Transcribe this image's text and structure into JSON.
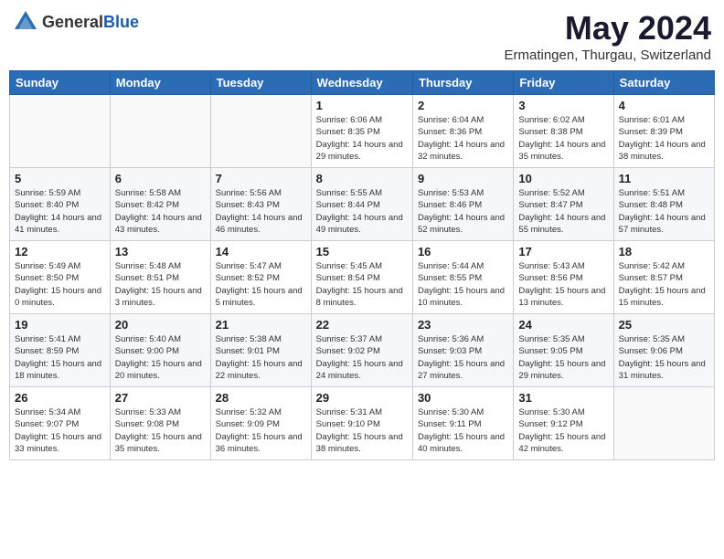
{
  "header": {
    "logo_general": "General",
    "logo_blue": "Blue",
    "month_year": "May 2024",
    "location": "Ermatingen, Thurgau, Switzerland"
  },
  "weekdays": [
    "Sunday",
    "Monday",
    "Tuesday",
    "Wednesday",
    "Thursday",
    "Friday",
    "Saturday"
  ],
  "weeks": [
    [
      {
        "day": "",
        "info": ""
      },
      {
        "day": "",
        "info": ""
      },
      {
        "day": "",
        "info": ""
      },
      {
        "day": "1",
        "info": "Sunrise: 6:06 AM\nSunset: 8:35 PM\nDaylight: 14 hours\nand 29 minutes."
      },
      {
        "day": "2",
        "info": "Sunrise: 6:04 AM\nSunset: 8:36 PM\nDaylight: 14 hours\nand 32 minutes."
      },
      {
        "day": "3",
        "info": "Sunrise: 6:02 AM\nSunset: 8:38 PM\nDaylight: 14 hours\nand 35 minutes."
      },
      {
        "day": "4",
        "info": "Sunrise: 6:01 AM\nSunset: 8:39 PM\nDaylight: 14 hours\nand 38 minutes."
      }
    ],
    [
      {
        "day": "5",
        "info": "Sunrise: 5:59 AM\nSunset: 8:40 PM\nDaylight: 14 hours\nand 41 minutes."
      },
      {
        "day": "6",
        "info": "Sunrise: 5:58 AM\nSunset: 8:42 PM\nDaylight: 14 hours\nand 43 minutes."
      },
      {
        "day": "7",
        "info": "Sunrise: 5:56 AM\nSunset: 8:43 PM\nDaylight: 14 hours\nand 46 minutes."
      },
      {
        "day": "8",
        "info": "Sunrise: 5:55 AM\nSunset: 8:44 PM\nDaylight: 14 hours\nand 49 minutes."
      },
      {
        "day": "9",
        "info": "Sunrise: 5:53 AM\nSunset: 8:46 PM\nDaylight: 14 hours\nand 52 minutes."
      },
      {
        "day": "10",
        "info": "Sunrise: 5:52 AM\nSunset: 8:47 PM\nDaylight: 14 hours\nand 55 minutes."
      },
      {
        "day": "11",
        "info": "Sunrise: 5:51 AM\nSunset: 8:48 PM\nDaylight: 14 hours\nand 57 minutes."
      }
    ],
    [
      {
        "day": "12",
        "info": "Sunrise: 5:49 AM\nSunset: 8:50 PM\nDaylight: 15 hours\nand 0 minutes."
      },
      {
        "day": "13",
        "info": "Sunrise: 5:48 AM\nSunset: 8:51 PM\nDaylight: 15 hours\nand 3 minutes."
      },
      {
        "day": "14",
        "info": "Sunrise: 5:47 AM\nSunset: 8:52 PM\nDaylight: 15 hours\nand 5 minutes."
      },
      {
        "day": "15",
        "info": "Sunrise: 5:45 AM\nSunset: 8:54 PM\nDaylight: 15 hours\nand 8 minutes."
      },
      {
        "day": "16",
        "info": "Sunrise: 5:44 AM\nSunset: 8:55 PM\nDaylight: 15 hours\nand 10 minutes."
      },
      {
        "day": "17",
        "info": "Sunrise: 5:43 AM\nSunset: 8:56 PM\nDaylight: 15 hours\nand 13 minutes."
      },
      {
        "day": "18",
        "info": "Sunrise: 5:42 AM\nSunset: 8:57 PM\nDaylight: 15 hours\nand 15 minutes."
      }
    ],
    [
      {
        "day": "19",
        "info": "Sunrise: 5:41 AM\nSunset: 8:59 PM\nDaylight: 15 hours\nand 18 minutes."
      },
      {
        "day": "20",
        "info": "Sunrise: 5:40 AM\nSunset: 9:00 PM\nDaylight: 15 hours\nand 20 minutes."
      },
      {
        "day": "21",
        "info": "Sunrise: 5:38 AM\nSunset: 9:01 PM\nDaylight: 15 hours\nand 22 minutes."
      },
      {
        "day": "22",
        "info": "Sunrise: 5:37 AM\nSunset: 9:02 PM\nDaylight: 15 hours\nand 24 minutes."
      },
      {
        "day": "23",
        "info": "Sunrise: 5:36 AM\nSunset: 9:03 PM\nDaylight: 15 hours\nand 27 minutes."
      },
      {
        "day": "24",
        "info": "Sunrise: 5:35 AM\nSunset: 9:05 PM\nDaylight: 15 hours\nand 29 minutes."
      },
      {
        "day": "25",
        "info": "Sunrise: 5:35 AM\nSunset: 9:06 PM\nDaylight: 15 hours\nand 31 minutes."
      }
    ],
    [
      {
        "day": "26",
        "info": "Sunrise: 5:34 AM\nSunset: 9:07 PM\nDaylight: 15 hours\nand 33 minutes."
      },
      {
        "day": "27",
        "info": "Sunrise: 5:33 AM\nSunset: 9:08 PM\nDaylight: 15 hours\nand 35 minutes."
      },
      {
        "day": "28",
        "info": "Sunrise: 5:32 AM\nSunset: 9:09 PM\nDaylight: 15 hours\nand 36 minutes."
      },
      {
        "day": "29",
        "info": "Sunrise: 5:31 AM\nSunset: 9:10 PM\nDaylight: 15 hours\nand 38 minutes."
      },
      {
        "day": "30",
        "info": "Sunrise: 5:30 AM\nSunset: 9:11 PM\nDaylight: 15 hours\nand 40 minutes."
      },
      {
        "day": "31",
        "info": "Sunrise: 5:30 AM\nSunset: 9:12 PM\nDaylight: 15 hours\nand 42 minutes."
      },
      {
        "day": "",
        "info": ""
      }
    ]
  ]
}
